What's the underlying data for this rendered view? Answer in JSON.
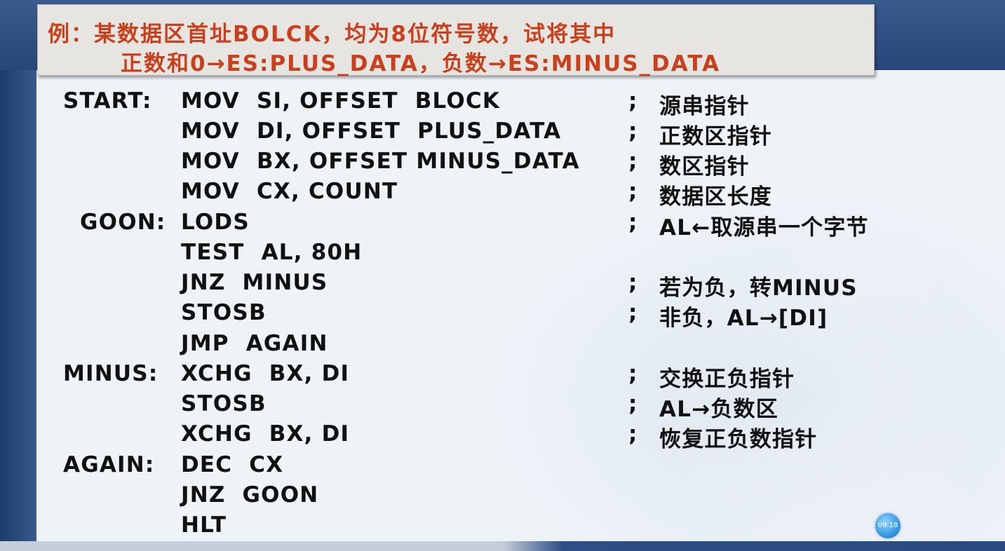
{
  "title": {
    "line1": "例：某数据区首址BOLCK，均为8位符号数，试将其中",
    "line2": "正数和0→ES:PLUS_DATA，负数→ES:MINUS_DATA"
  },
  "code": [
    {
      "label": "START:",
      "instr": "MOV  SI, OFFSET  BLOCK",
      "comment": "源串指针"
    },
    {
      "label": "",
      "instr": "MOV  DI, OFFSET  PLUS_DATA",
      "comment": "正数区指针"
    },
    {
      "label": "",
      "instr": "MOV  BX, OFFSET MINUS_DATA",
      "comment": "数区指针"
    },
    {
      "label": "",
      "instr": "MOV  CX, COUNT",
      "comment": "数据区长度"
    },
    {
      "label": "GOON:",
      "instr": "LODS",
      "comment": "AL←取源串一个字节"
    },
    {
      "label": "",
      "instr": "TEST  AL, 80H",
      "comment": ""
    },
    {
      "label": "",
      "instr": "JNZ  MINUS",
      "comment": "若为负，转MINUS"
    },
    {
      "label": "",
      "instr": "STOSB",
      "comment": "非负，AL→[DI]"
    },
    {
      "label": "",
      "instr": "JMP  AGAIN",
      "comment": ""
    },
    {
      "label": "MINUS:",
      "instr": "XCHG  BX, DI",
      "comment": "交换正负指针"
    },
    {
      "label": "",
      "instr": "STOSB",
      "comment": "AL→负数区"
    },
    {
      "label": "",
      "instr": "XCHG  BX, DI",
      "comment": "恢复正负数指针"
    },
    {
      "label": "AGAIN:",
      "instr": "DEC  CX",
      "comment": ""
    },
    {
      "label": "",
      "instr": "JNZ  GOON",
      "comment": ""
    },
    {
      "label": "",
      "instr": "HLT",
      "comment": ""
    }
  ],
  "semicolon": ";",
  "timestamp_badge": "09:18",
  "colors": {
    "title_text": "#c8401c",
    "code_text": "#111111",
    "top_band": "#2f4d7c"
  }
}
